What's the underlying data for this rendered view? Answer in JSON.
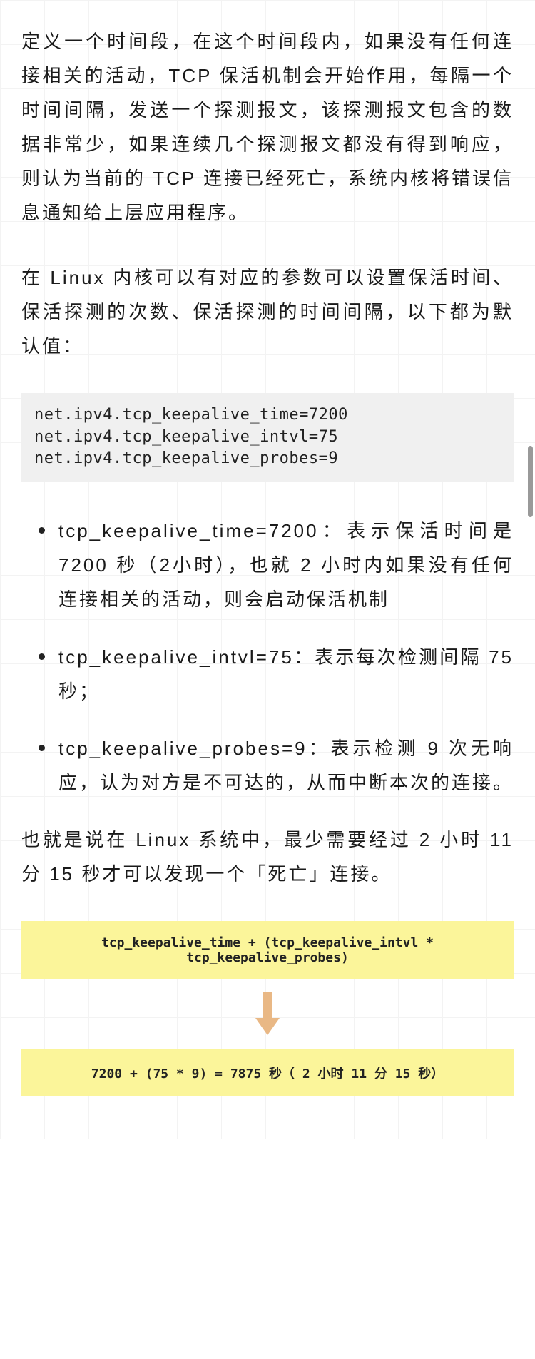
{
  "para1": "定义一个时间段，在这个时间段内，如果没有任何连接相关的活动，TCP 保活机制会开始作用，每隔一个时间间隔，发送一个探测报文，该探测报文包含的数据非常少，如果连续几个探测报文都没有得到响应，则认为当前的 TCP 连接已经死亡，系统内核将错误信息通知给上层应用程序。",
  "para2": "在 Linux 内核可以有对应的参数可以设置保活时间、保活探测的次数、保活探测的时间间隔，以下都为默认值：",
  "code": "net.ipv4.tcp_keepalive_time=7200\nnet.ipv4.tcp_keepalive_intvl=75\nnet.ipv4.tcp_keepalive_probes=9",
  "bullets": [
    "tcp_keepalive_time=7200：表示保活时间是 7200 秒（2小时），也就 2 小时内如果没有任何连接相关的活动，则会启动保活机制",
    "tcp_keepalive_intvl=75：表示每次检测间隔 75 秒；",
    "tcp_keepalive_probes=9：表示检测 9 次无响应，认为对方是不可达的，从而中断本次的连接。"
  ],
  "para3": "也就是说在 Linux 系统中，最少需要经过 2 小时 11 分 15 秒才可以发现一个「死亡」连接。",
  "formula1": "tcp_keepalive_time +  (tcp_keepalive_intvl * tcp_keepalive_probes)",
  "formula2": "7200 +  (75 * 9)  = 7875 秒（ 2 小时 11 分 15 秒）"
}
